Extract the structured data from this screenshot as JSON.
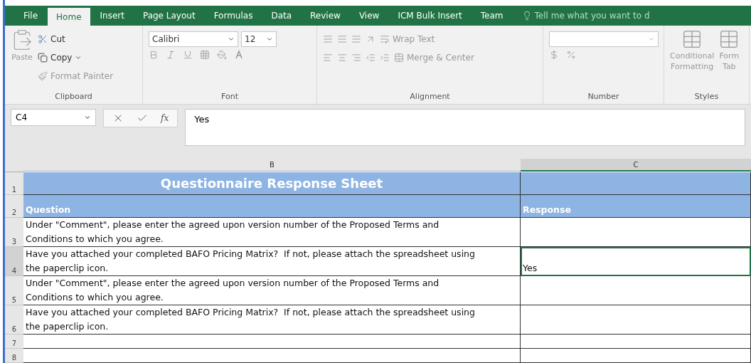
{
  "ribbon_tabs": [
    {
      "label": "File",
      "selected": false
    },
    {
      "label": "Home",
      "selected": true
    },
    {
      "label": "Insert",
      "selected": false
    },
    {
      "label": "Page Layout",
      "selected": false
    },
    {
      "label": "Formulas",
      "selected": false
    },
    {
      "label": "Data",
      "selected": false
    },
    {
      "label": "Review",
      "selected": false
    },
    {
      "label": "View",
      "selected": false
    },
    {
      "label": "ICM Bulk Insert",
      "selected": false
    },
    {
      "label": "Team",
      "selected": false
    }
  ],
  "tell_me": "Tell me what you want to d",
  "clipboard": {
    "paste": "Paste",
    "cut": "Cut",
    "copy": "Copy",
    "format_painter": "Format Painter",
    "label": "Clipboard"
  },
  "font": {
    "name": "Calibri",
    "size": "12",
    "label": "Font"
  },
  "alignment": {
    "wrap_text": "Wrap Text",
    "merge_center": "Merge & Center",
    "label": "Alignment"
  },
  "number": {
    "label": "Number"
  },
  "styles": {
    "conditional_formatting": [
      "Conditional",
      "Formatting"
    ],
    "format_table": [
      "Form",
      "Tab"
    ],
    "label": "Styles"
  },
  "formula_bar": {
    "name_box": "C4",
    "function_label": "fx",
    "formula": "Yes"
  },
  "columns": [
    {
      "label": "B",
      "selected": false
    },
    {
      "label": "C",
      "selected": true
    }
  ],
  "rows": [
    {
      "number": "1",
      "kind": "title",
      "cells": [
        "Questionnaire Response Sheet",
        ""
      ]
    },
    {
      "number": "2",
      "kind": "header",
      "cells": [
        "Question",
        "Response"
      ]
    },
    {
      "number": "3",
      "kind": "data",
      "active": false,
      "cells": [
        "Under \"Comment\", please enter the agreed upon version number of the Proposed Terms and\nConditions to which you agree.",
        ""
      ]
    },
    {
      "number": "4",
      "kind": "data",
      "active": true,
      "cells": [
        "Have you attached your completed BAFO Pricing Matrix?  If not, please attach the spreadsheet using\nthe paperclip icon.",
        "Yes"
      ]
    },
    {
      "number": "5",
      "kind": "data",
      "active": false,
      "cells": [
        "Under \"Comment\", please enter the agreed upon version number of the Proposed Terms and\nConditions to which you agree.",
        ""
      ]
    },
    {
      "number": "6",
      "kind": "data",
      "active": false,
      "cells": [
        "Have you attached your completed BAFO Pricing Matrix?  If not, please attach the spreadsheet using\nthe paperclip icon.",
        ""
      ]
    },
    {
      "number": "7",
      "kind": "empty",
      "active": false,
      "cells": [
        "",
        ""
      ]
    },
    {
      "number": "8",
      "kind": "empty",
      "active": false,
      "cells": [
        "",
        ""
      ]
    }
  ]
}
